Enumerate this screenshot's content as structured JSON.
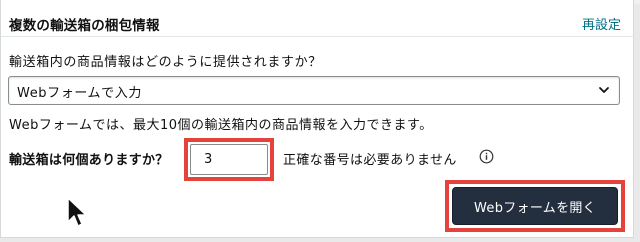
{
  "header": {
    "title": "複数の輸送箱の梱包情報",
    "reset_link": "再設定"
  },
  "form": {
    "question": "輸送箱内の商品情報はどのように提供されますか？",
    "select": {
      "value": "Webフォームで入力"
    },
    "note": "Webフォームでは、最大10個の輸送箱内の商品情報を入力できます。",
    "box_count": {
      "label": "輸送箱は何個ありますか？",
      "value": "3",
      "hint": "正確な番号は必要ありません"
    },
    "open_button": "Webフォームを開く"
  },
  "colors": {
    "link": "#007185",
    "button_bg": "#232f3e",
    "highlight": "#e4433b"
  },
  "icons": [
    "chevron-down-icon",
    "info-icon",
    "mouse-pointer-icon"
  ]
}
